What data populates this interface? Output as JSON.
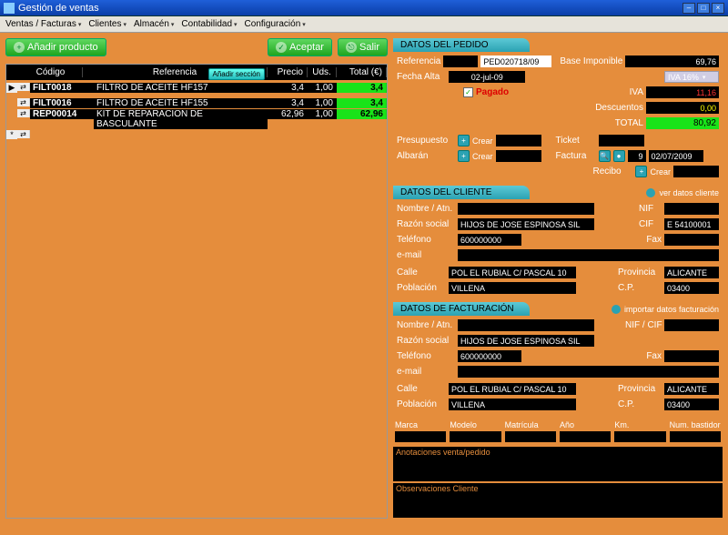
{
  "window": {
    "title": "Gestión de ventas"
  },
  "menubar": [
    "Ventas / Facturas",
    "Clientes",
    "Almacén",
    "Contabilidad",
    "Configuración"
  ],
  "buttons": {
    "add_product": "Añadir producto",
    "accept": "Aceptar",
    "exit": "Salir",
    "add_section": "Añadir sección",
    "crear": "Crear"
  },
  "table": {
    "headers": {
      "code": "Código",
      "ref": "Referencia",
      "price": "Precio",
      "units": "Uds.",
      "total": "Total (€)"
    },
    "rows": [
      {
        "mark": "▶",
        "code": "FILT0018",
        "ref": "FILTRO DE ACEITE HF157",
        "price": "3,4",
        "units": "1,00",
        "total": "3,4"
      },
      {
        "mark": "",
        "code": "FILT0016",
        "ref": "FILTRO DE ACEITE HF155",
        "price": "3,4",
        "units": "1,00",
        "total": "3,4"
      },
      {
        "mark": "",
        "code": "REP00014",
        "ref": "KIT DE REPARACION DE BASCULANTE",
        "price": "62,96",
        "units": "1,00",
        "total": "62,96"
      },
      {
        "mark": "*",
        "code": "",
        "ref": "",
        "price": "",
        "units": "",
        "total": ""
      }
    ]
  },
  "panels": {
    "order": {
      "title": "DATOS DEL PEDIDO",
      "labels": {
        "referencia": "Referencia",
        "fecha_alta": "Fecha Alta",
        "pagado": "Pagado",
        "base": "Base Imponible",
        "iva": "IVA",
        "descuentos": "Descuentos",
        "total": "TOTAL",
        "presupuesto": "Presupuesto",
        "albaran": "Albarán",
        "ticket": "Ticket",
        "factura": "Factura",
        "recibo": "Recibo"
      },
      "values": {
        "ref": "PED020718/09",
        "fecha": "02-jul-09",
        "pagado_checked": "✓",
        "base": "69,76",
        "iva_pct": "IVA 16%",
        "iva": "11,16",
        "desc": "0,00",
        "total": "80,92",
        "factura_num": "9",
        "factura_date": "02/07/2009"
      }
    },
    "client": {
      "title": "DATOS DEL CLIENTE",
      "link": "ver datos cliente",
      "labels": {
        "nombre": "Nombre / Atn.",
        "razon": "Razón social",
        "telefono": "Teléfono",
        "email": "e-mail",
        "calle": "Calle",
        "poblacion": "Población",
        "nif": "NIF",
        "cif": "CIF",
        "fax": "Fax",
        "provincia": "Provincia",
        "cp": "C.P."
      },
      "values": {
        "razon": "HIJOS DE JOSE ESPINOSA SIL",
        "telefono": "600000000",
        "cif": "E 54100001",
        "calle": "POL EL RUBIAL C/ PASCAL 10",
        "poblacion": "VILLENA",
        "provincia": "ALICANTE",
        "cp": "03400"
      }
    },
    "billing": {
      "title": "DATOS DE FACTURACIÓN",
      "link": "importar datos facturación",
      "labels": {
        "nombre": "Nombre / Atn.",
        "razon": "Razón social",
        "telefono": "Teléfono",
        "email": "e-mail",
        "calle": "Calle",
        "poblacion": "Población",
        "nifcif": "NIF / CIF",
        "fax": "Fax",
        "provincia": "Provincia",
        "cp": "C.P."
      },
      "values": {
        "razon": "HIJOS DE JOSE ESPINOSA SIL",
        "telefono": "600000000",
        "calle": "POL EL RUBIAL C/ PASCAL 10",
        "poblacion": "VILLENA",
        "provincia": "ALICANTE",
        "cp": "03400"
      }
    },
    "vehicle": {
      "headers": [
        "Marca",
        "Modelo",
        "Matrícula",
        "Año",
        "Km.",
        "Num. bastidor"
      ]
    },
    "notes_sale": "Anotaciones venta/pedido",
    "notes_client": "Observaciones Cliente"
  }
}
